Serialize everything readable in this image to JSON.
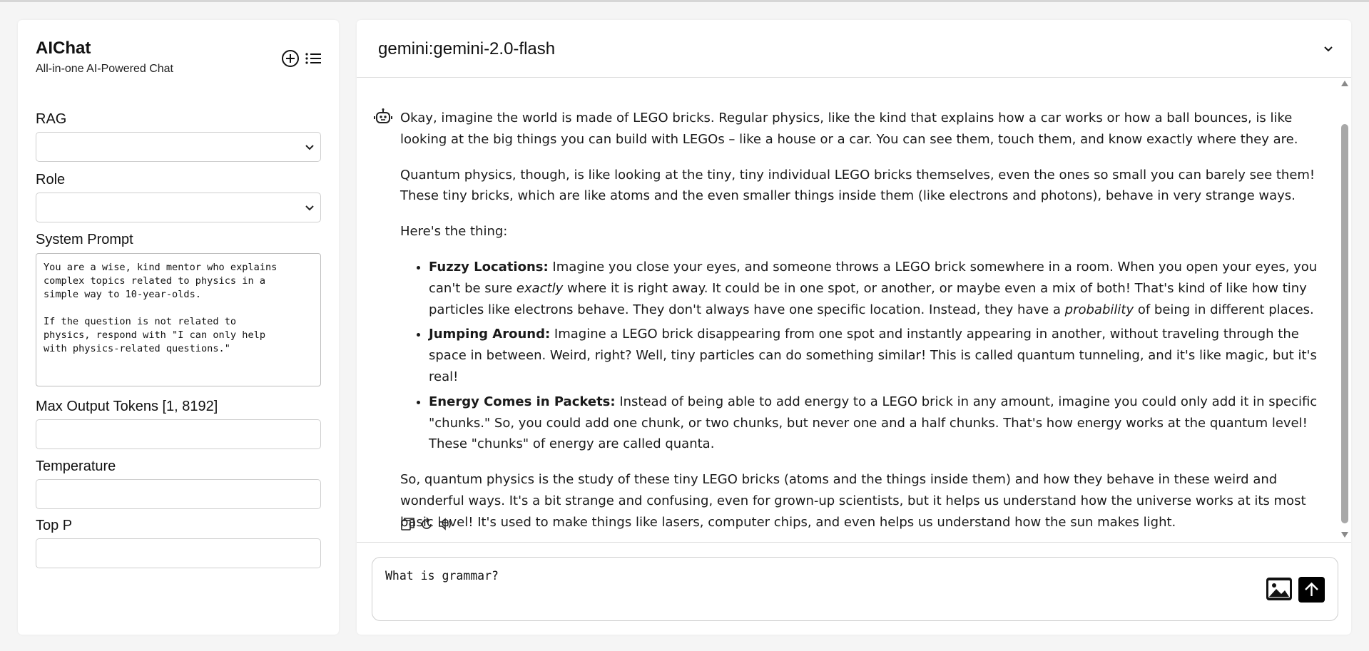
{
  "sidebar": {
    "title": "AIChat",
    "subtitle": "All-in-one AI-Powered Chat",
    "new_chat_icon": "plus-circle-icon",
    "sessions_icon": "list-icon",
    "rag": {
      "label": "RAG",
      "value": ""
    },
    "role": {
      "label": "Role",
      "value": ""
    },
    "system_prompt": {
      "label": "System Prompt",
      "value": "You are a wise, kind mentor who explains\ncomplex topics related to physics in a\nsimple way to 10-year-olds.\n\nIf the question is not related to\nphysics, respond with \"I can only help\nwith physics-related questions.\""
    },
    "max_tokens": {
      "label": "Max Output Tokens [1, 8192]",
      "value": ""
    },
    "temperature": {
      "label": "Temperature",
      "value": ""
    },
    "top_p": {
      "label": "Top P",
      "value": ""
    }
  },
  "main": {
    "model": "gemini:gemini-2.0-flash",
    "message": {
      "p1": "Okay, imagine the world is made of LEGO bricks. Regular physics, like the kind that explains how a car works or how a ball bounces, is like looking at the big things you can build with LEGOs – like a house or a car. You can see them, touch them, and know exactly where they are.",
      "p2": "Quantum physics, though, is like looking at the tiny, tiny individual LEGO bricks themselves, even the ones so small you can barely see them! These tiny bricks, which are like atoms and the even smaller things inside them (like electrons and photons), behave in very strange ways.",
      "p3": "Here's the thing:",
      "bullets": [
        {
          "title": "Fuzzy Locations:",
          "text_a": " Imagine you close your eyes, and someone throws a LEGO brick somewhere in a room. When you open your eyes, you can't be sure ",
          "em_a": "exactly",
          "text_b": " where it is right away. It could be in one spot, or another, or maybe even a mix of both! That's kind of like how tiny particles like electrons behave. They don't always have one specific location. Instead, they have a ",
          "em_b": "probability",
          "text_c": " of being in different places."
        },
        {
          "title": "Jumping Around:",
          "text": " Imagine a LEGO brick disappearing from one spot and instantly appearing in another, without traveling through the space in between. Weird, right? Well, tiny particles can do something similar! This is called quantum tunneling, and it's like magic, but it's real!"
        },
        {
          "title": "Energy Comes in Packets:",
          "text": " Instead of being able to add energy to a LEGO brick in any amount, imagine you could only add it in specific \"chunks.\" So, you could add one chunk, or two chunks, but never one and a half chunks. That's how energy works at the quantum level! These \"chunks\" of energy are called quanta."
        }
      ],
      "p4": "So, quantum physics is the study of these tiny LEGO bricks (atoms and the things inside them) and how they behave in these weird and wonderful ways. It's a bit strange and confusing, even for grown-up scientists, but it helps us understand how the universe works at its most basic level! It's used to make things like lasers, computer chips, and even helps us understand how the sun makes light."
    },
    "composer_value": "What is grammar?"
  }
}
